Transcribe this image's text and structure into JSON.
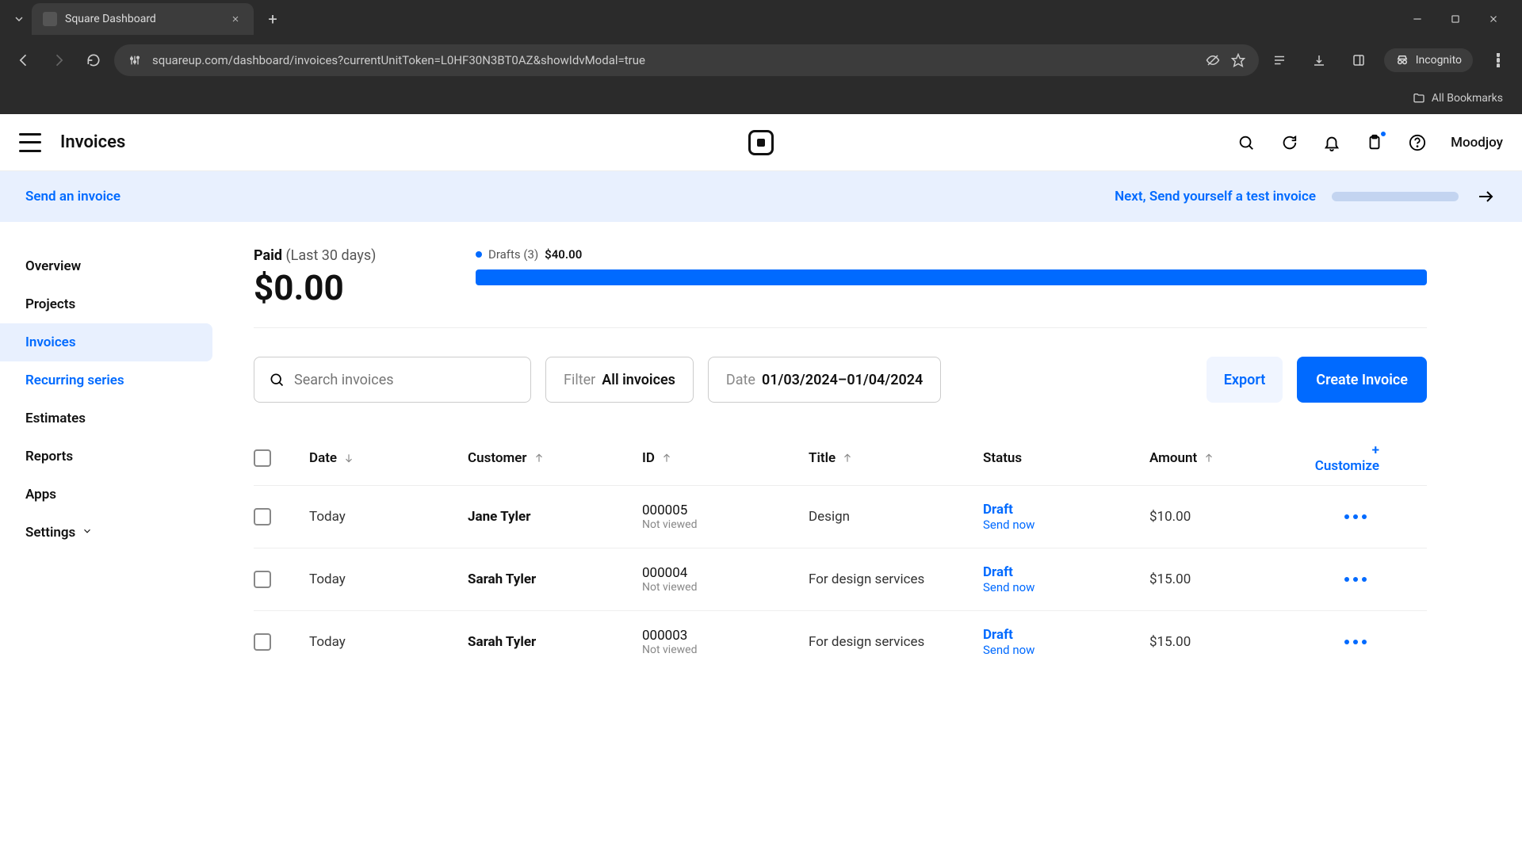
{
  "browser": {
    "tab_title": "Square Dashboard",
    "url": "squareup.com/dashboard/invoices?currentUnitToken=L0HF30N3BT0AZ&showIdvModal=true",
    "incognito": "Incognito",
    "all_bookmarks": "All Bookmarks"
  },
  "header": {
    "title": "Invoices",
    "user": "Moodjoy"
  },
  "banner": {
    "left": "Send an invoice",
    "next": "Next, Send yourself a test invoice"
  },
  "sidebar": {
    "items": [
      {
        "label": "Overview"
      },
      {
        "label": "Projects"
      },
      {
        "label": "Invoices"
      },
      {
        "label": "Recurring series"
      },
      {
        "label": "Estimates"
      },
      {
        "label": "Reports"
      },
      {
        "label": "Apps"
      },
      {
        "label": "Settings"
      }
    ]
  },
  "stats": {
    "paid_label": "Paid",
    "paid_period": "(Last 30 days)",
    "paid_amount": "$0.00",
    "drafts_label": "Drafts (3)",
    "drafts_amount": "$40.00"
  },
  "filters": {
    "search_placeholder": "Search invoices",
    "filter_label": "Filter",
    "filter_value": "All invoices",
    "date_label": "Date",
    "date_value": "01/03/2024–01/04/2024",
    "export": "Export",
    "create": "Create Invoice"
  },
  "table": {
    "columns": {
      "date": "Date",
      "customer": "Customer",
      "id": "ID",
      "title": "Title",
      "status": "Status",
      "amount": "Amount",
      "customize": "+ Customize"
    },
    "rows": [
      {
        "date": "Today",
        "customer": "Jane Tyler",
        "id": "000005",
        "id_sub": "Not viewed",
        "title": "Design",
        "status": "Draft",
        "status_sub": "Send now",
        "amount": "$10.00"
      },
      {
        "date": "Today",
        "customer": "Sarah Tyler",
        "id": "000004",
        "id_sub": "Not viewed",
        "title": "For design services",
        "status": "Draft",
        "status_sub": "Send now",
        "amount": "$15.00"
      },
      {
        "date": "Today",
        "customer": "Sarah Tyler",
        "id": "000003",
        "id_sub": "Not viewed",
        "title": "For design services",
        "status": "Draft",
        "status_sub": "Send now",
        "amount": "$15.00"
      }
    ]
  }
}
